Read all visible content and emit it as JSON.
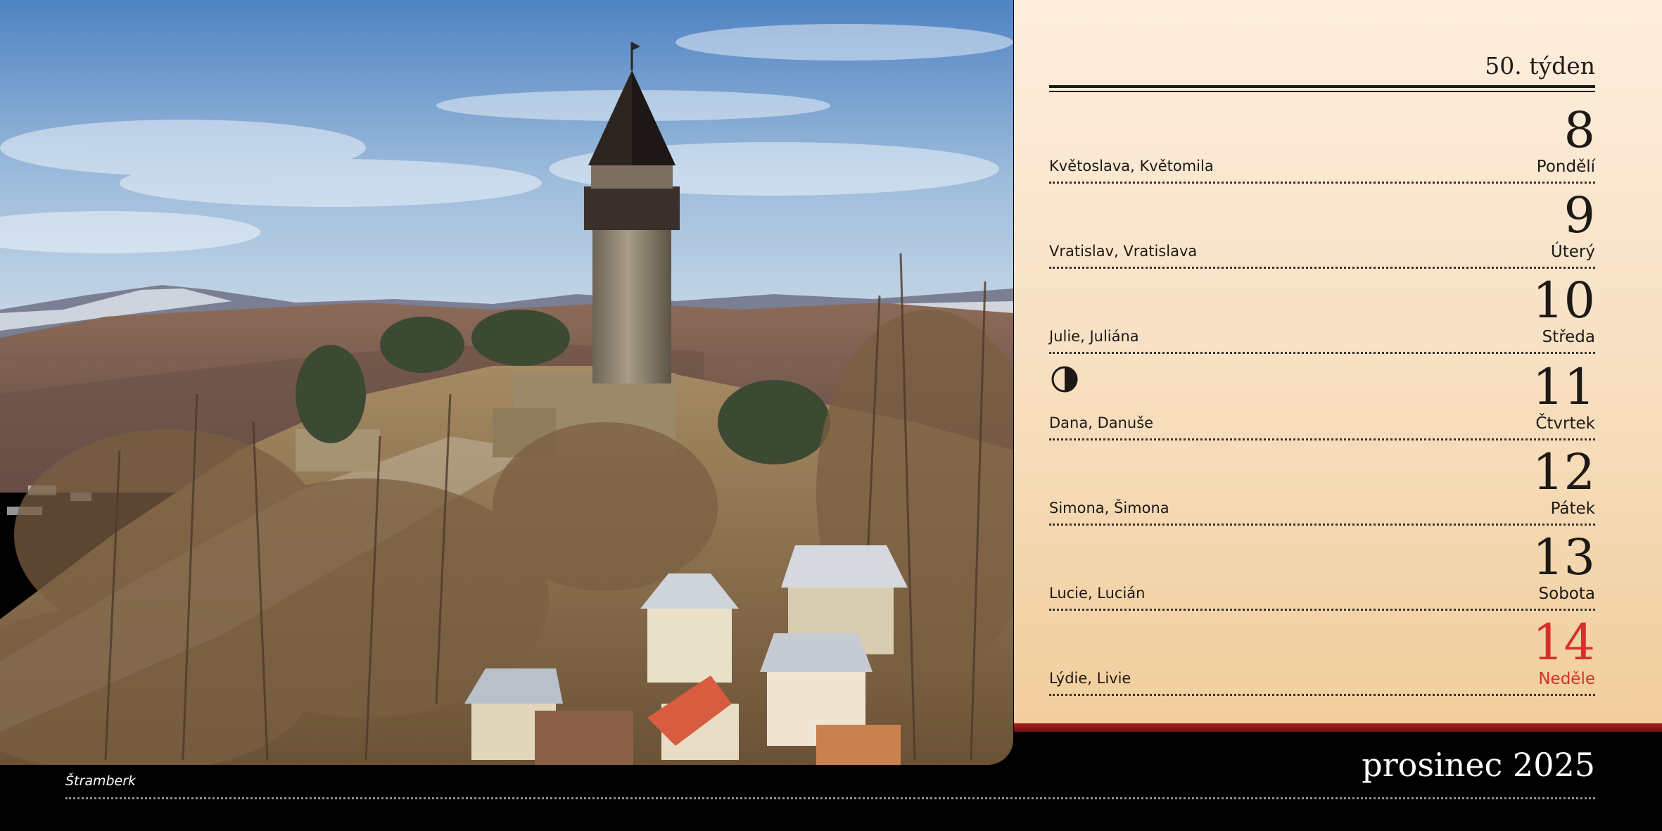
{
  "week_label": "50. týden",
  "days": [
    {
      "number": "8",
      "weekday": "Pondělí",
      "names": "Květoslava, Květomila"
    },
    {
      "number": "9",
      "weekday": "Úterý",
      "names": "Vratislav, Vratislava"
    },
    {
      "number": "10",
      "weekday": "Středa",
      "names": "Julie, Juliána"
    },
    {
      "number": "11",
      "weekday": "Čtvrtek",
      "names": "Dana, Danuše",
      "moon_icon": "first-quarter-moon-icon"
    },
    {
      "number": "12",
      "weekday": "Pátek",
      "names": "Simona, Šimona"
    },
    {
      "number": "13",
      "weekday": "Sobota",
      "names": "Lucie, Lucián"
    },
    {
      "number": "14",
      "weekday": "Neděle",
      "names": "Lýdie, Livie",
      "is_sunday": true
    }
  ],
  "month_label": "prosinec 2025",
  "photo_caption": "Štramberk",
  "colors": {
    "sunday": "#d6312a",
    "accent_stripe": "#a91d1d",
    "panel_bg": "#f8e2c6",
    "footer_bg": "#000000"
  }
}
